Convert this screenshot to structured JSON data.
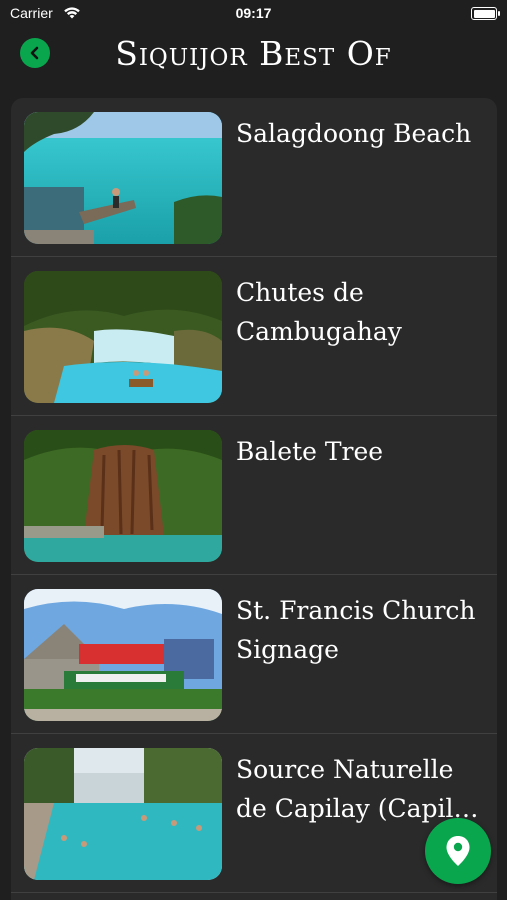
{
  "status_bar": {
    "carrier": "Carrier",
    "time": "09:17",
    "battery_level": 1.0
  },
  "header": {
    "title": "Siquijor Best Of",
    "back_icon": "chevron-left-icon"
  },
  "places": [
    {
      "title": "Salagdoong Beach",
      "image": "beach-photo"
    },
    {
      "title": "Chutes de Cambugahay",
      "image": "waterfall-photo"
    },
    {
      "title": "Balete Tree",
      "image": "tree-photo"
    },
    {
      "title": "St. Francis Church Signage",
      "image": "church-photo"
    },
    {
      "title": "Source Naturelle de Capilay (Capilay Spring Park)",
      "image": "spring-pool-photo"
    }
  ],
  "fab": {
    "icon": "map-pin-icon"
  },
  "colors": {
    "accent": "#0aa64e",
    "background": "#1f1f1f",
    "card": "#2a2a2a"
  }
}
